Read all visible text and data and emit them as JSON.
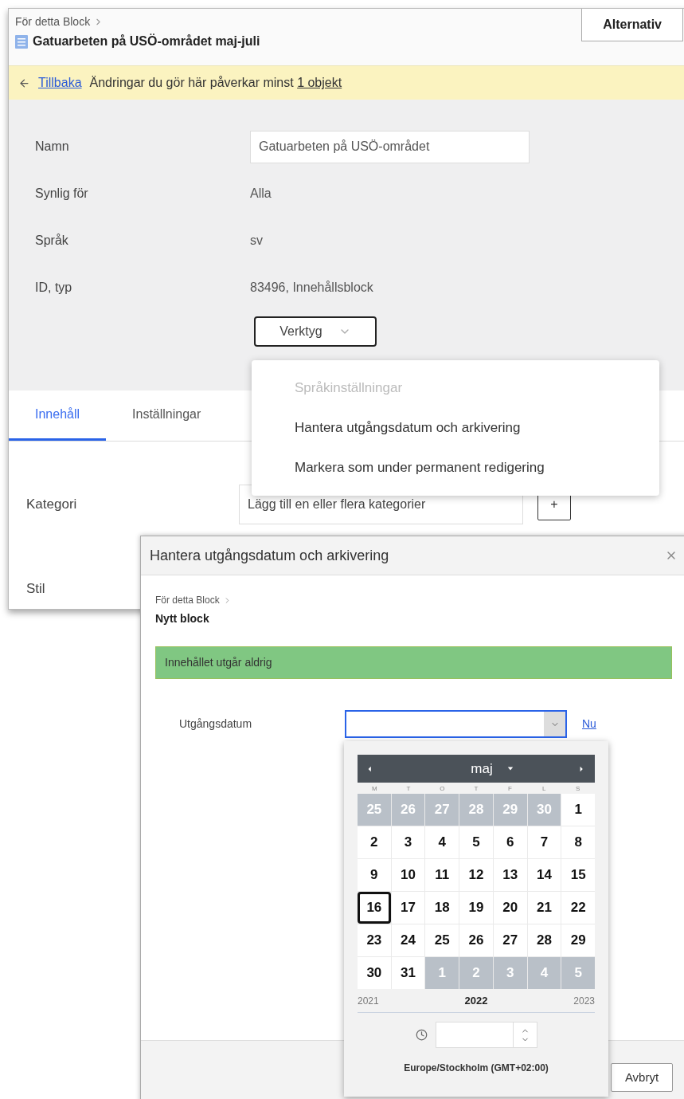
{
  "page": {
    "breadcrumb": "För detta Block",
    "title": "Gatuarbeten på USÖ-området maj-juli",
    "options_button": "Alternativ"
  },
  "notice": {
    "back_link": "Tillbaka",
    "text": "Ändringar du gör här påverkar minst ",
    "link": "1 objekt"
  },
  "properties": [
    {
      "label": "Namn",
      "kind": "input",
      "value": "Gatuarbeten på USÖ-området"
    },
    {
      "label": "Synlig för",
      "kind": "text",
      "value": "Alla"
    },
    {
      "label": "Språk",
      "kind": "text",
      "value": "sv"
    },
    {
      "label": "ID, typ",
      "kind": "text",
      "value": "83496, Innehållsblock"
    }
  ],
  "tools_button": "Verktyg",
  "tools_menu": [
    {
      "label": "Språkinställningar",
      "disabled": true
    },
    {
      "label": "Hantera utgångsdatum och arkivering",
      "disabled": false
    },
    {
      "label": "Markera som under permanent redigering",
      "disabled": false
    }
  ],
  "tabs": [
    {
      "label": "Innehåll",
      "selected": true
    },
    {
      "label": "Inställningar",
      "selected": false
    }
  ],
  "content_fields": [
    {
      "label": "Kategori",
      "placeholder": "Lägg till en eller flera kategorier",
      "add_button": "+"
    },
    {
      "label": "Stil"
    }
  ],
  "dialog": {
    "title": "Hantera utgångsdatum och arkivering",
    "breadcrumb": "För detta Block",
    "heading": "Nytt block",
    "status": "Innehållet utgår aldrig",
    "date_label": "Utgångsdatum",
    "now_link": "Nu",
    "cancel_button": "Avbryt",
    "calendar": {
      "month": "maj",
      "weekdays": [
        "M",
        "T",
        "O",
        "T",
        "F",
        "L",
        "S"
      ],
      "weeks": [
        [
          {
            "day": "25",
            "outside": true,
            "selected": false
          },
          {
            "day": "26",
            "outside": true,
            "selected": false
          },
          {
            "day": "27",
            "outside": true,
            "selected": false
          },
          {
            "day": "28",
            "outside": true,
            "selected": false
          },
          {
            "day": "29",
            "outside": true,
            "selected": false
          },
          {
            "day": "30",
            "outside": true,
            "selected": false
          },
          {
            "day": "1",
            "outside": false,
            "selected": false
          }
        ],
        [
          {
            "day": "2",
            "outside": false,
            "selected": false
          },
          {
            "day": "3",
            "outside": false,
            "selected": false
          },
          {
            "day": "4",
            "outside": false,
            "selected": false
          },
          {
            "day": "5",
            "outside": false,
            "selected": false
          },
          {
            "day": "6",
            "outside": false,
            "selected": false
          },
          {
            "day": "7",
            "outside": false,
            "selected": false
          },
          {
            "day": "8",
            "outside": false,
            "selected": false
          }
        ],
        [
          {
            "day": "9",
            "outside": false,
            "selected": false
          },
          {
            "day": "10",
            "outside": false,
            "selected": false
          },
          {
            "day": "11",
            "outside": false,
            "selected": false
          },
          {
            "day": "12",
            "outside": false,
            "selected": false
          },
          {
            "day": "13",
            "outside": false,
            "selected": false
          },
          {
            "day": "14",
            "outside": false,
            "selected": false
          },
          {
            "day": "15",
            "outside": false,
            "selected": false
          }
        ],
        [
          {
            "day": "16",
            "outside": false,
            "selected": true
          },
          {
            "day": "17",
            "outside": false,
            "selected": false
          },
          {
            "day": "18",
            "outside": false,
            "selected": false
          },
          {
            "day": "19",
            "outside": false,
            "selected": false
          },
          {
            "day": "20",
            "outside": false,
            "selected": false
          },
          {
            "day": "21",
            "outside": false,
            "selected": false
          },
          {
            "day": "22",
            "outside": false,
            "selected": false
          }
        ],
        [
          {
            "day": "23",
            "outside": false,
            "selected": false
          },
          {
            "day": "24",
            "outside": false,
            "selected": false
          },
          {
            "day": "25",
            "outside": false,
            "selected": false
          },
          {
            "day": "26",
            "outside": false,
            "selected": false
          },
          {
            "day": "27",
            "outside": false,
            "selected": false
          },
          {
            "day": "28",
            "outside": false,
            "selected": false
          },
          {
            "day": "29",
            "outside": false,
            "selected": false
          }
        ],
        [
          {
            "day": "30",
            "outside": false,
            "selected": false
          },
          {
            "day": "31",
            "outside": false,
            "selected": false
          },
          {
            "day": "1",
            "outside": true,
            "selected": false
          },
          {
            "day": "2",
            "outside": true,
            "selected": false
          },
          {
            "day": "3",
            "outside": true,
            "selected": false
          },
          {
            "day": "4",
            "outside": true,
            "selected": false
          },
          {
            "day": "5",
            "outside": true,
            "selected": false
          }
        ]
      ],
      "years": [
        {
          "label": "2021",
          "selected": false
        },
        {
          "label": "2022",
          "selected": true
        },
        {
          "label": "2023",
          "selected": false
        }
      ],
      "timezone": "Europe/Stockholm (GMT+02:00)"
    }
  }
}
